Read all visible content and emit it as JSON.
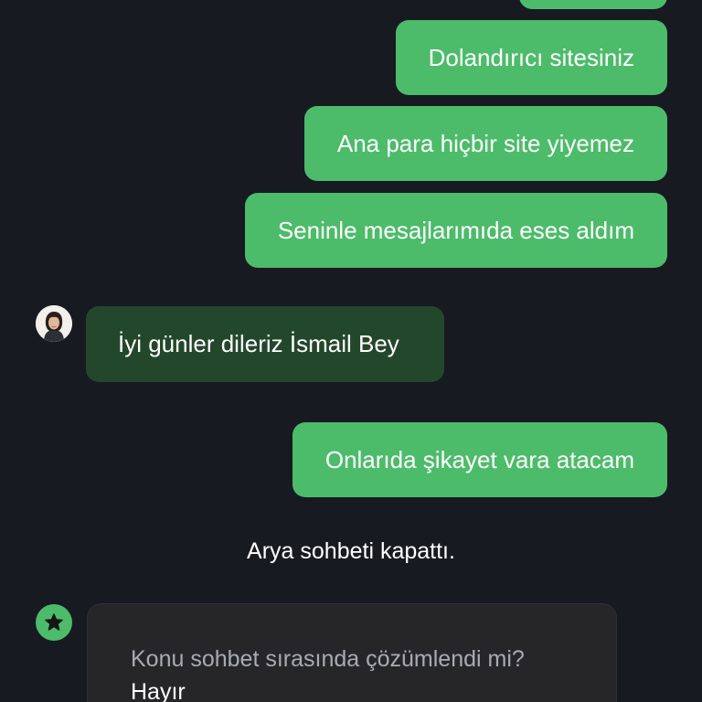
{
  "theme": {
    "background": "#181a22",
    "outgoing_bubble": "#4cbc6a",
    "incoming_bubble": "#23472b",
    "survey_card": "#262629"
  },
  "conversation": {
    "outgoing_messages": [
      "Dolandırıcı sitesiniz",
      "Ana para hiçbir site yiyemez",
      "Seninle mesajlarımıda eses aldım"
    ],
    "agent_message": "İyi günler dileriz İsmail Bey",
    "outgoing_after": "Onlarıda şikayet vara atacam",
    "system_message": "Arya sohbeti kapattı."
  },
  "survey": {
    "icon": "star-icon",
    "question": "Konu sohbet sırasında çözümlendi mi?",
    "answer": "Hayır"
  },
  "agent": {
    "avatar_icon": "agent-avatar"
  }
}
